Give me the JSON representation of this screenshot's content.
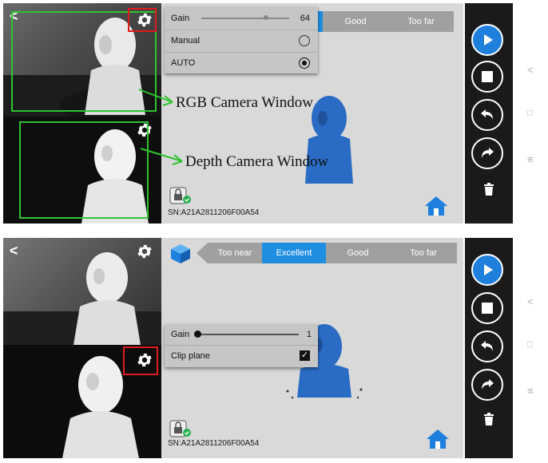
{
  "screens": {
    "top": {
      "gain": {
        "label": "Gain",
        "value": "64",
        "level": 0.72
      },
      "modes": [
        {
          "label": "Manual",
          "selected": false
        },
        {
          "label": "AUTO",
          "selected": true
        }
      ],
      "quality": [
        "Good",
        "Too far"
      ],
      "serial": "SN:A21A2811206F00A54",
      "annotations": {
        "rgb": "RGB Camera Window",
        "depth": "Depth Camera Window"
      }
    },
    "bottom": {
      "quality": [
        "Too near",
        "Excellent",
        "Good",
        "Too far"
      ],
      "quality_active": "Excellent",
      "gain": {
        "label": "Gain",
        "value": "1",
        "level": 0.02
      },
      "clip": {
        "label": "Clip plane",
        "checked": true
      },
      "serial": "SN:A21A2811206F00A54"
    }
  },
  "icons": {
    "back": "back-arrow-icon",
    "settings": "gear-icon",
    "play": "play-icon",
    "stop": "stop-icon",
    "undo": "undo-icon",
    "redo": "redo-icon",
    "delete": "trash-icon",
    "home": "home-icon",
    "cube": "cube-icon"
  },
  "colors": {
    "accent": "#1f8ee0",
    "callout_green": "#2fc32f",
    "callout_red": "#e01b1b",
    "scan_blue": "#2a6cc4"
  }
}
